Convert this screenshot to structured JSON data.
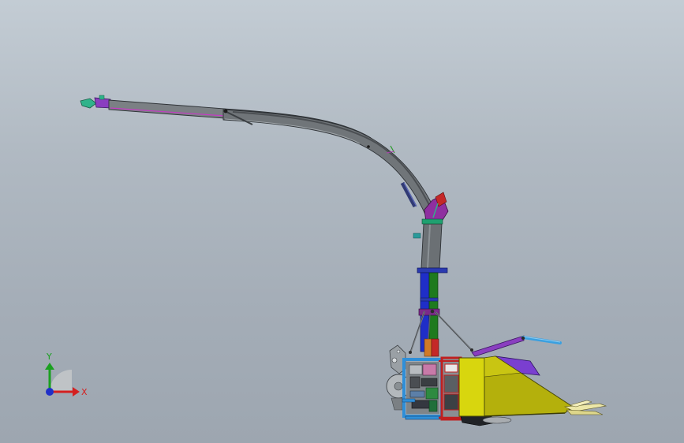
{
  "viewport": {
    "background_top": "#c3ccd4",
    "background_bottom": "#9da6b0"
  },
  "triad": {
    "x_label": "X",
    "y_label": "Y",
    "x_color": "#d42020",
    "y_color": "#1aa020",
    "z_color": "#2030c8"
  },
  "model": {
    "description_icon": "forage-harvester-chute-model",
    "colors": {
      "chute_gray": "#6f7478",
      "chute_dark": "#3f4347",
      "deflector_green": "#2fb38a",
      "deflector_purple": "#8a3ec0",
      "mast_blue": "#1f2ec8",
      "mast_green": "#1e7a1e",
      "frame_blue": "#2f8fd8",
      "frame_red": "#c02020",
      "hopper_yellow": "#d8d60e",
      "hopper_olive": "#b4b00c",
      "lid_purple": "#7a3fd0",
      "tube_blue": "#3aa0e0"
    }
  }
}
